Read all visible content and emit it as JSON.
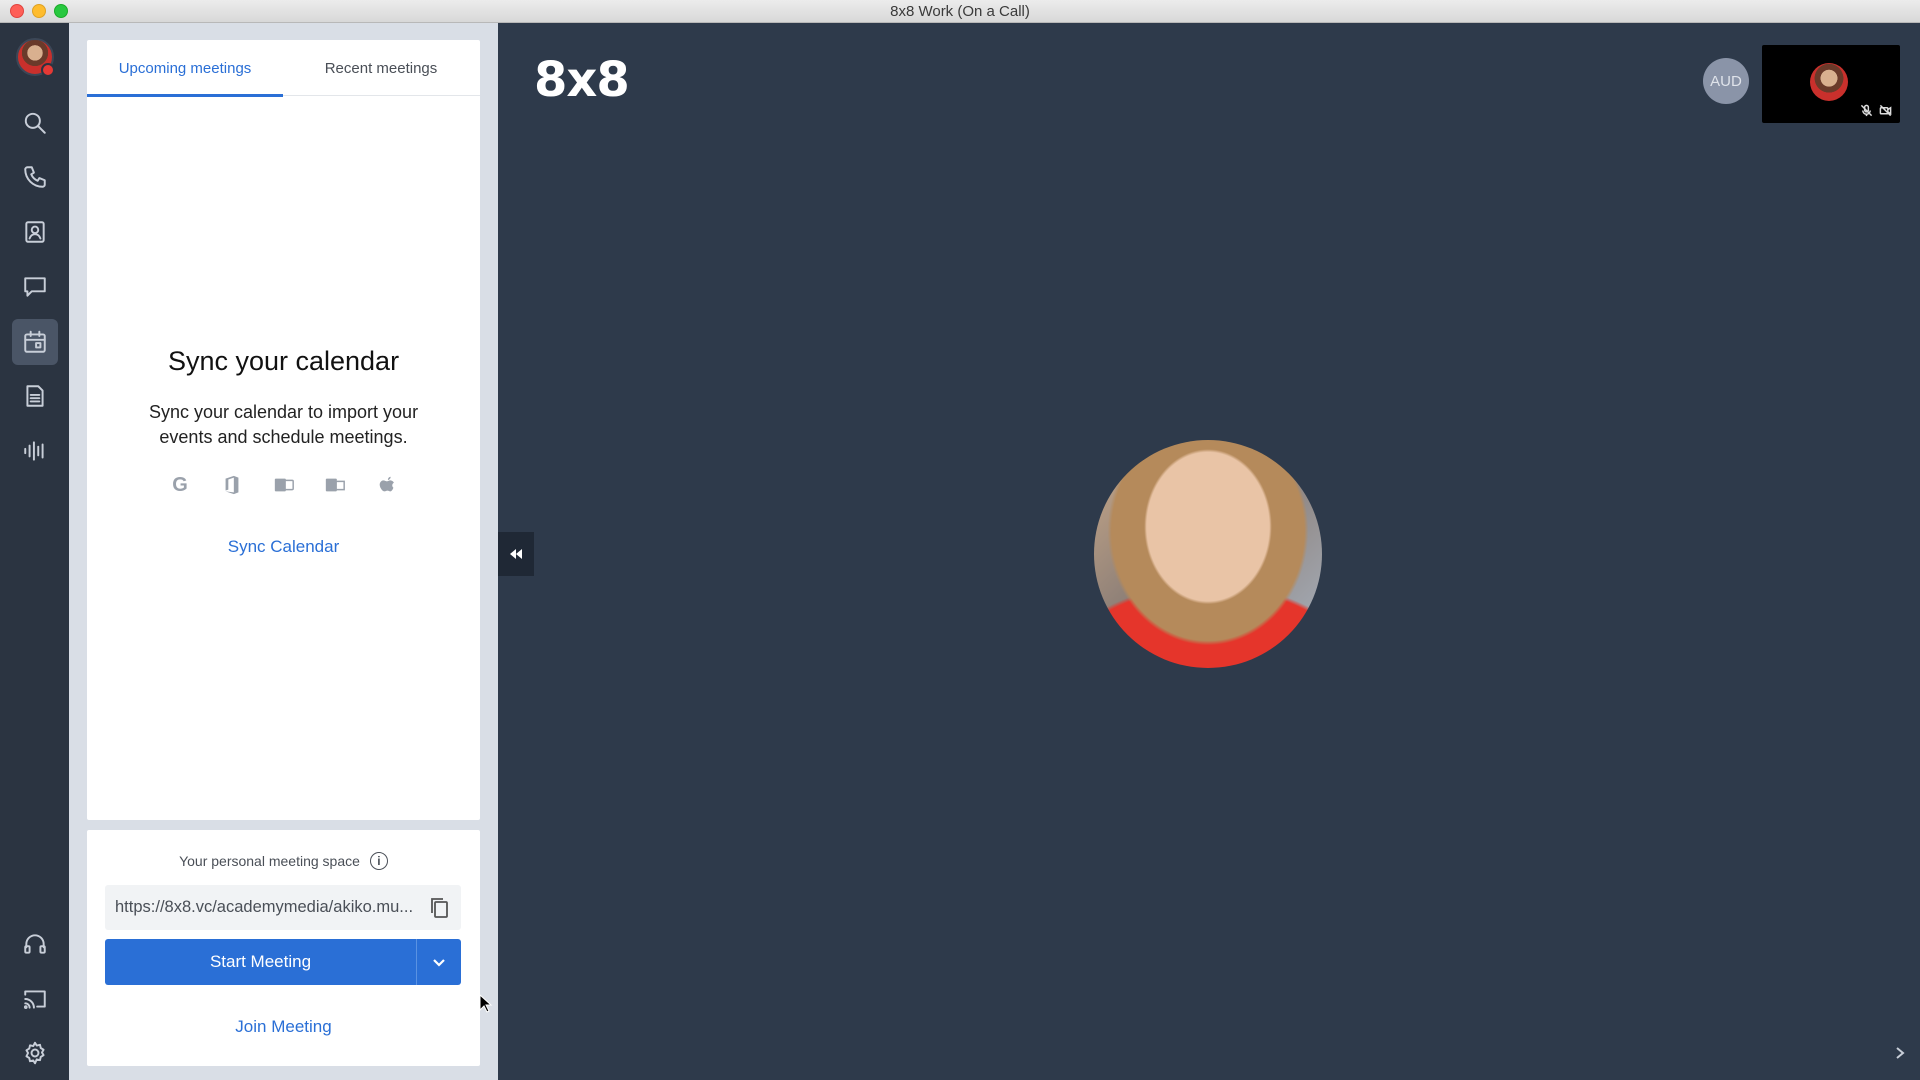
{
  "window": {
    "title": "8x8 Work (On a Call)"
  },
  "rail": {
    "items": [
      {
        "name": "search"
      },
      {
        "name": "phone"
      },
      {
        "name": "contacts"
      },
      {
        "name": "messages"
      },
      {
        "name": "meetings",
        "active": true
      },
      {
        "name": "documents"
      },
      {
        "name": "voicemail"
      },
      {
        "name": "support"
      },
      {
        "name": "cast"
      },
      {
        "name": "settings"
      }
    ]
  },
  "meetings": {
    "tabs": [
      {
        "label": "Upcoming meetings",
        "active": true
      },
      {
        "label": "Recent meetings",
        "active": false
      }
    ],
    "sync": {
      "title": "Sync your calendar",
      "description": "Sync your calendar to import your events and schedule meetings.",
      "link": "Sync Calendar",
      "providers": [
        "google-icon",
        "office365-icon",
        "exchange-icon",
        "outlook-icon",
        "apple-icon"
      ]
    },
    "personal_space": {
      "label": "Your personal meeting space",
      "url": "https://8x8.vc/academymedia/akiko.mu..."
    },
    "start_button": "Start Meeting",
    "join_link": "Join Meeting"
  },
  "stage": {
    "logo": "8x8",
    "aud_badge": "AUD"
  },
  "colors": {
    "accent": "#2a6fd6",
    "stage_bg": "#2e3a4b",
    "rail_bg": "#2b3441"
  }
}
